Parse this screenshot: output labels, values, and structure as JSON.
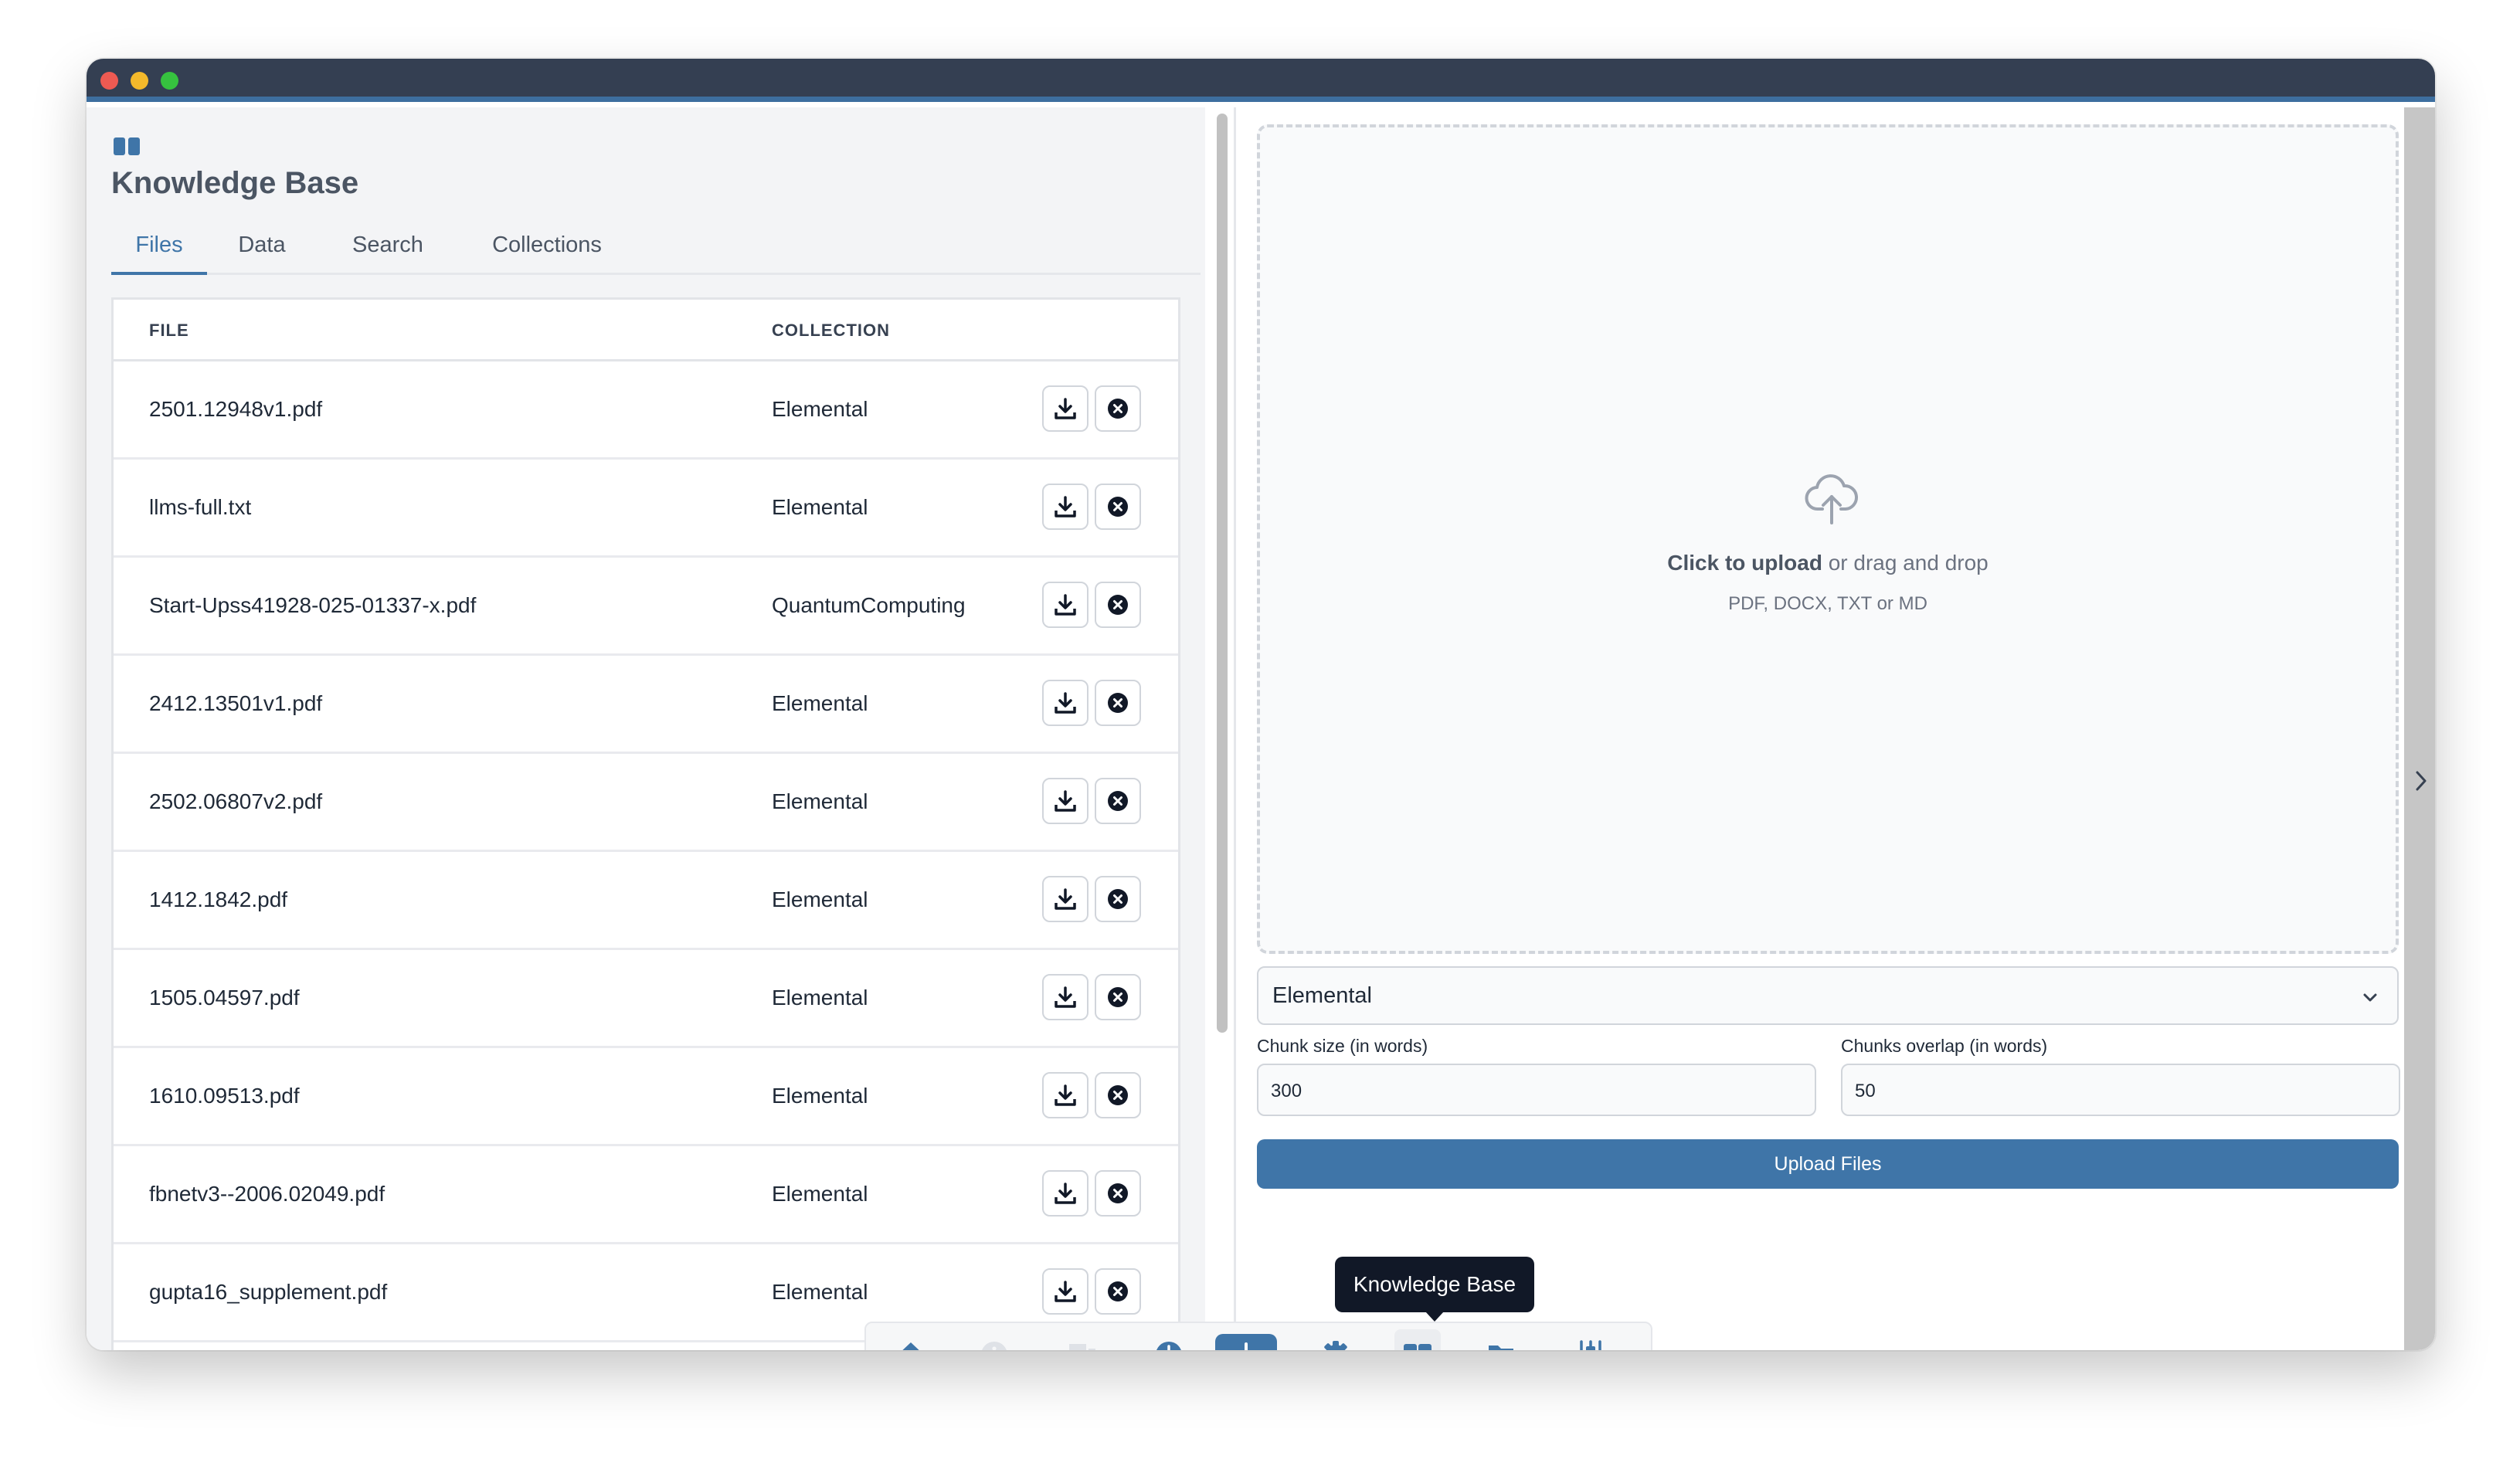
{
  "window": {
    "controls": [
      "close",
      "minimize",
      "maximize"
    ]
  },
  "knowledge_base": {
    "icon": "book-open-icon",
    "title": "Knowledge Base",
    "tabs": [
      {
        "label": "Files",
        "active": true
      },
      {
        "label": "Data",
        "active": false
      },
      {
        "label": "Search",
        "active": false
      },
      {
        "label": "Collections",
        "active": false
      }
    ]
  },
  "files_table": {
    "headers": {
      "file": "FILE",
      "collection": "COLLECTION"
    },
    "rows": [
      {
        "file": "2501.12948v1.pdf",
        "collection": "Elemental"
      },
      {
        "file": "llms-full.txt",
        "collection": "Elemental"
      },
      {
        "file": "Start-Upss41928-025-01337-x.pdf",
        "collection": "QuantumComputing"
      },
      {
        "file": "2412.13501v1.pdf",
        "collection": "Elemental"
      },
      {
        "file": "2502.06807v2.pdf",
        "collection": "Elemental"
      },
      {
        "file": "1412.1842.pdf",
        "collection": "Elemental"
      },
      {
        "file": "1505.04597.pdf",
        "collection": "Elemental"
      },
      {
        "file": "1610.09513.pdf",
        "collection": "Elemental"
      },
      {
        "file": "fbnetv3--2006.02049.pdf",
        "collection": "Elemental"
      },
      {
        "file": "gupta16_supplement.pdf",
        "collection": "Elemental"
      }
    ],
    "row_actions": [
      "download-icon",
      "delete-icon"
    ]
  },
  "upload": {
    "icon": "cloud-upload-icon",
    "click_text": "Click to upload",
    "drag_text": " or drag and drop",
    "formats": "PDF, DOCX, TXT or MD",
    "collection_select": {
      "value": "Elemental"
    },
    "chunk_size": {
      "label": "Chunk size (in words)",
      "value": "300"
    },
    "chunk_overlap": {
      "label": "Chunks overlap (in words)",
      "value": "50"
    },
    "button_label": "Upload Files"
  },
  "dock": {
    "tooltip": "Knowledge Base",
    "items": [
      "home-icon",
      "info-icon",
      "chat-icon",
      "history-icon",
      "plus-icon",
      "settings-icon",
      "knowledge-base-icon",
      "folder-icon",
      "sliders-icon"
    ],
    "active": "knowledge-base-icon"
  },
  "colors": {
    "accent": "#3f75a8",
    "titlebar": "#343f52",
    "tooltip": "#111827"
  }
}
